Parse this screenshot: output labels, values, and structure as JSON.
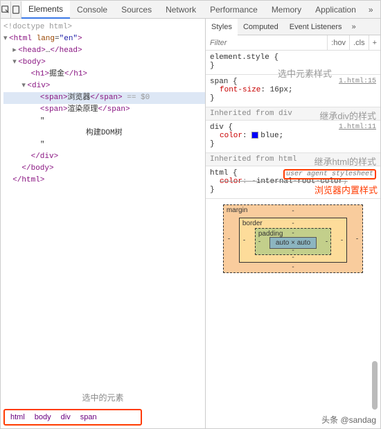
{
  "topbar": {
    "tabs": [
      "Elements",
      "Console",
      "Sources",
      "Network",
      "Performance",
      "Memory",
      "Application"
    ],
    "more_glyph": "»",
    "menu_glyph": "⋮",
    "close_glyph": "✕"
  },
  "dom_tree": {
    "doctype": "<!doctype html>",
    "html_open": "<html lang=\"en\">",
    "head": {
      "open": "<head>",
      "close": "</head>",
      "ellipsis": "…"
    },
    "body_open": "<body>",
    "h1": {
      "open": "<h1>",
      "text": "掘金",
      "close": "</h1>"
    },
    "div_open": "<div>",
    "span1": {
      "open": "<span>",
      "text": "浏览器",
      "close": "</span>",
      "hint": " == $0"
    },
    "span2": {
      "open": "<span>",
      "text": "渲染原理",
      "close": "</span>"
    },
    "quote": "\"",
    "comment_text": "构建DOM树",
    "div_close": "</div>",
    "body_close": "</body>",
    "html_close": "</html>"
  },
  "left_annot": "选中的元素",
  "breadcrumb": [
    "html",
    "body",
    "div",
    "span"
  ],
  "styles_pane": {
    "tabs": [
      "Styles",
      "Computed",
      "Event Listeners"
    ],
    "more_glyph": "»",
    "filter_placeholder": "Filter",
    "hov": ":hov",
    "cls": ".cls",
    "plus": "+",
    "rules": [
      {
        "kind": "rule",
        "selector": "element.style",
        "props": []
      },
      {
        "kind": "rule",
        "selector": "span",
        "src": "1.html:15",
        "annot": "选中元素样式",
        "props": [
          {
            "k": "font-size",
            "v": "16px"
          }
        ]
      },
      {
        "kind": "inherited",
        "label": "Inherited from",
        "element": "div",
        "annot": "继承div的样式"
      },
      {
        "kind": "rule",
        "selector": "div",
        "src": "1.html:11",
        "props": [
          {
            "k": "color",
            "v": "blue",
            "swatch": "#0000ff"
          }
        ]
      },
      {
        "kind": "inherited",
        "label": "Inherited from",
        "element": "html",
        "annot": "继承html的样式"
      },
      {
        "kind": "rule",
        "selector": "html",
        "ua": "user agent stylesheet",
        "ua_annot": "浏览器内置样式",
        "props": [
          {
            "k": "color",
            "v": "-internal-root-color",
            "struck": true
          }
        ]
      }
    ]
  },
  "box_model": {
    "labels": {
      "margin": "margin",
      "border": "border",
      "padding": "padding"
    },
    "content": "auto × auto",
    "dash": "-"
  },
  "footer": "头条 @sandag"
}
